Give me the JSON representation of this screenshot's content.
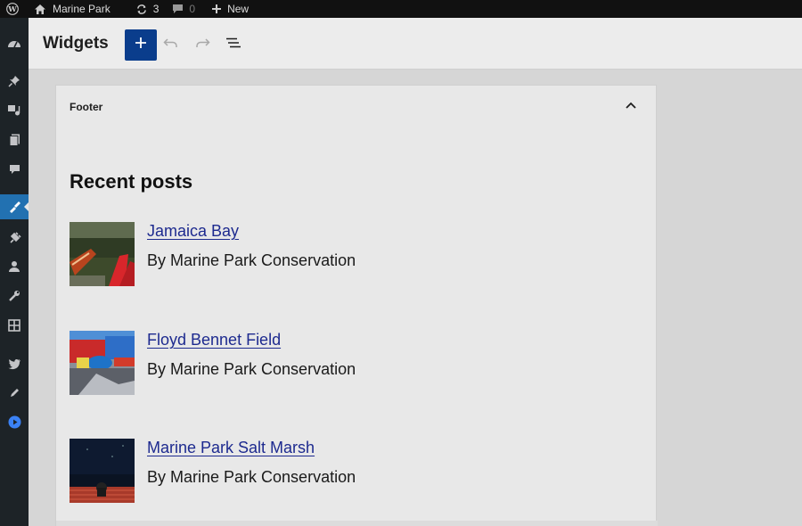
{
  "admin_bar": {
    "site_name": "Marine Park",
    "updates_count": "3",
    "comments_count": "0",
    "new_label": "New"
  },
  "editor": {
    "title": "Widgets"
  },
  "widget_area": {
    "title": "Footer",
    "heading": "Recent posts",
    "posts": [
      {
        "title": "Jamaica Bay",
        "byline": "By Marine Park Conservation"
      },
      {
        "title": "Floyd Bennet Field",
        "byline": "By Marine Park Conservation"
      },
      {
        "title": "Marine Park Salt Marsh",
        "byline": "By Marine Park Conservation"
      }
    ]
  },
  "colors": {
    "accent": "#0a3d8c",
    "admin_active": "#2271b1",
    "link": "#1d2a8f"
  }
}
